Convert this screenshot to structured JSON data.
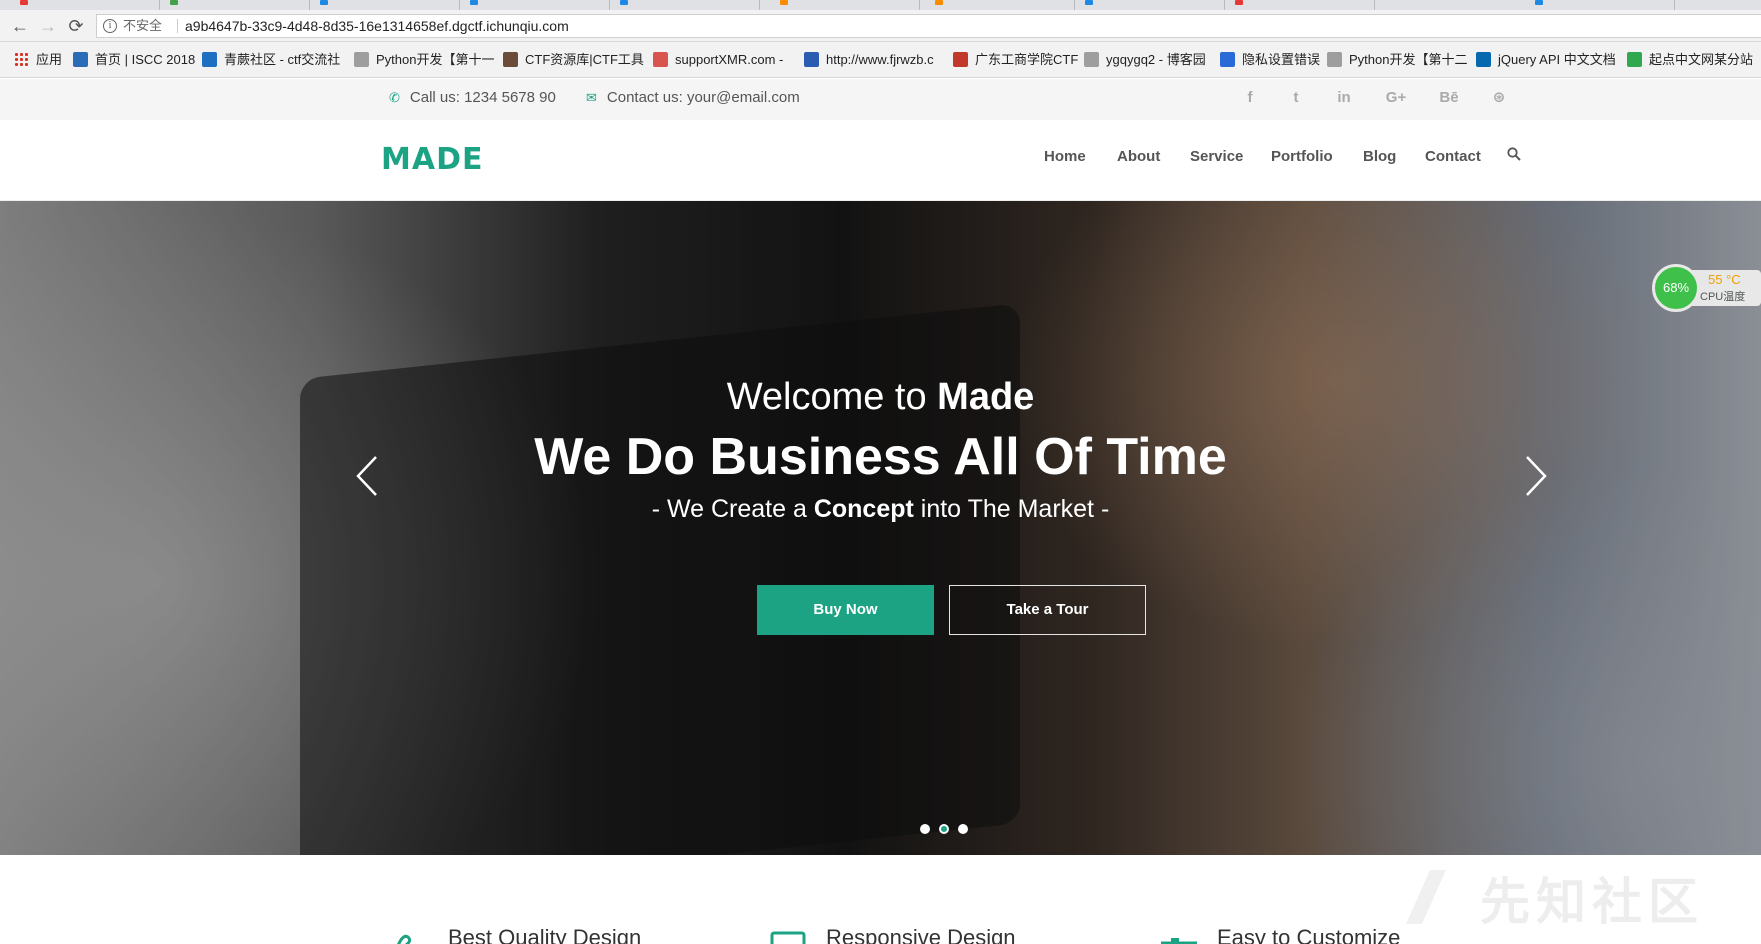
{
  "browser": {
    "security_label": "不安全",
    "url": "a9b4647b-33c9-4d48-8d35-16e1314658ef.dgctf.ichunqiu.com",
    "bookmarks": [
      {
        "label": "应用",
        "color": "#d93025"
      },
      {
        "label": "首页 | ISCC 2018",
        "color": "#2b6cb8"
      },
      {
        "label": "青蕨社区 - ctf交流社",
        "color": "#1e6fc2"
      },
      {
        "label": "Python开发【第十一",
        "color": "#666666"
      },
      {
        "label": "CTF资源库|CTF工具",
        "color": "#6b4c3b"
      },
      {
        "label": "supportXMR.com -",
        "color": "#d9534f"
      },
      {
        "label": "http://www.fjrwzb.c",
        "color": "#2a5db0"
      },
      {
        "label": "广东工商学院CTF",
        "color": "#c0392b"
      },
      {
        "label": "ygqygq2 - 博客园",
        "color": "#666666"
      },
      {
        "label": "隐私设置错误",
        "color": "#2a6ad6"
      },
      {
        "label": "Python开发【第十二",
        "color": "#666666"
      },
      {
        "label": "jQuery API 中文文档",
        "color": "#0769ad"
      },
      {
        "label": "起点中文网某分站",
        "color": "#2fa84f"
      }
    ]
  },
  "topbar": {
    "phone": "Call us: 1234 5678 90",
    "email": "Contact us: your@email.com",
    "social": [
      "f",
      "t",
      "in",
      "G+",
      "Bē",
      "⊛"
    ]
  },
  "header": {
    "logo": "MADE",
    "nav": [
      "Home",
      "About",
      "Service",
      "Portfolio",
      "Blog",
      "Contact"
    ]
  },
  "hero": {
    "welcome_prefix": "Welcome to ",
    "welcome_brand": "Made",
    "title": "We Do Business All Of Time",
    "sub_prefix": "- We Create a ",
    "sub_bold": "Concept",
    "sub_suffix": " into The Market -",
    "buy_label": "Buy Now",
    "tour_label": "Take a Tour",
    "slides": 3,
    "active_slide": 1
  },
  "cpu_widget": {
    "percent": "68%",
    "temp": "55 °C",
    "label": "CPU温度"
  },
  "features": [
    {
      "label": "Best Quality Design"
    },
    {
      "label": "Responsive Design"
    },
    {
      "label": "Easy to Customize"
    }
  ],
  "watermark": "先知社区",
  "colors": {
    "accent": "#1ba384"
  }
}
